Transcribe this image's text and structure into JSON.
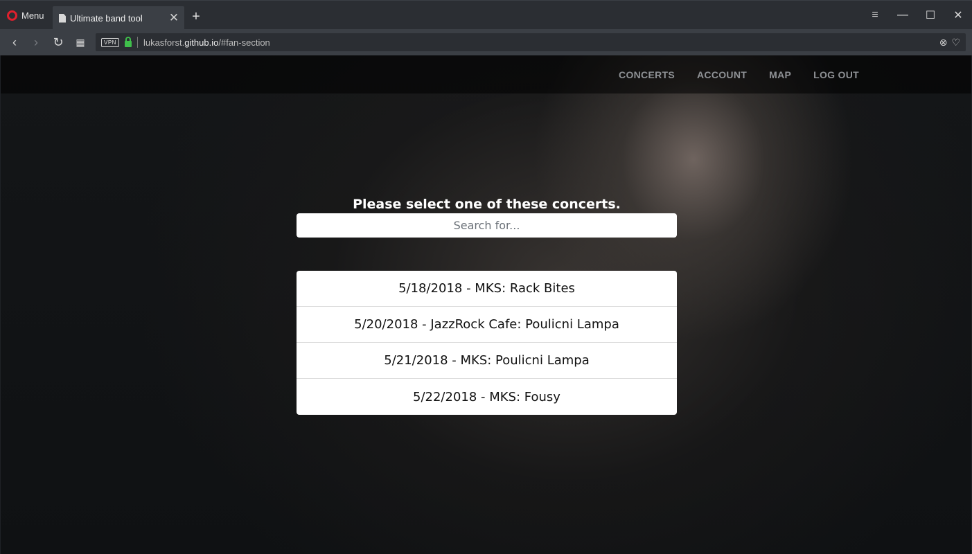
{
  "browser": {
    "menu_label": "Menu",
    "tab_title": "Ultimate band tool",
    "tab_close": "✕",
    "new_tab": "+",
    "vpn_label": "VPN",
    "url_prefix": "lukasforst.",
    "url_domain": "github.io",
    "url_path": "/#fan-section",
    "window_controls": {
      "minimize": "—",
      "maximize": "☐",
      "close": "✕",
      "tab_menu": "≡"
    },
    "nav_icons": {
      "back": "‹",
      "forward": "›",
      "reload": "↻",
      "speed_dial": "▦"
    },
    "url_icons": {
      "adblock": "⊗",
      "bookmark": "♡"
    }
  },
  "site_nav": {
    "items": [
      {
        "label": "CONCERTS"
      },
      {
        "label": "ACCOUNT"
      },
      {
        "label": "MAP"
      },
      {
        "label": "LOG OUT"
      }
    ]
  },
  "main": {
    "prompt": "Please select one of these concerts.",
    "search_placeholder": "Search for...",
    "concerts": [
      {
        "label": "5/18/2018 - MKS: Rack Bites"
      },
      {
        "label": "5/20/2018 - JazzRock Cafe: Poulicni Lampa"
      },
      {
        "label": "5/21/2018 - MKS: Poulicni Lampa"
      },
      {
        "label": "5/22/2018 - MKS: Fousy"
      }
    ]
  }
}
